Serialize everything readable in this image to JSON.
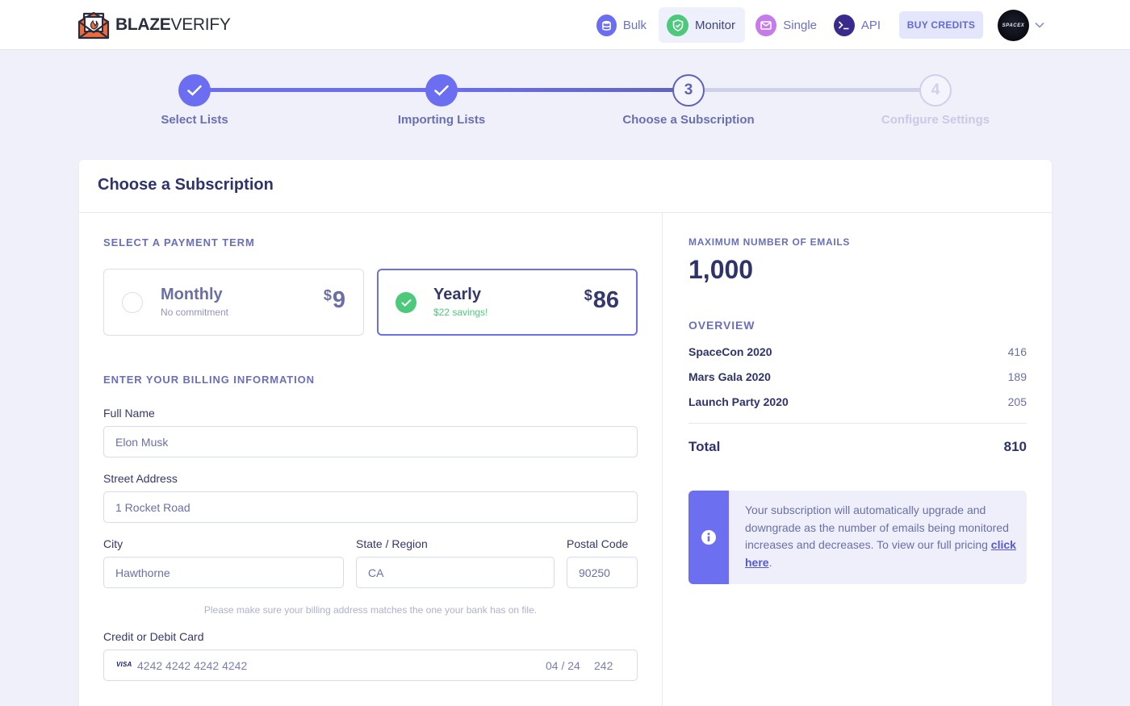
{
  "brand": {
    "name_bold": "BLAZE",
    "name_light": "VERIFY"
  },
  "nav": {
    "items": [
      {
        "label": "Bulk",
        "icon": "database-icon",
        "color": "#6b6ef0"
      },
      {
        "label": "Monitor",
        "icon": "shield-check-icon",
        "color": "#4cc97a",
        "active": true
      },
      {
        "label": "Single",
        "icon": "envelope-icon",
        "color": "#c57be8"
      },
      {
        "label": "API",
        "icon": "terminal-icon",
        "color": "#3a2a8e"
      }
    ],
    "buy_credits": "BUY CREDITS",
    "avatar_text": "SPACEX"
  },
  "stepper": {
    "steps": [
      {
        "label": "Select Lists",
        "state": "done",
        "number": "1"
      },
      {
        "label": "Importing Lists",
        "state": "done",
        "number": "2"
      },
      {
        "label": "Choose a Subscription",
        "state": "current",
        "number": "3"
      },
      {
        "label": "Configure Settings",
        "state": "todo",
        "number": "4"
      }
    ]
  },
  "card": {
    "title": "Choose a Subscription",
    "payment_term_label": "SELECT A PAYMENT TERM",
    "terms": {
      "monthly": {
        "name": "Monthly",
        "sub": "No commitment",
        "currency": "$",
        "price": "9",
        "selected": false
      },
      "yearly": {
        "name": "Yearly",
        "sub": "$22 savings!",
        "currency": "$",
        "price": "86",
        "selected": true
      }
    },
    "billing_label": "ENTER YOUR BILLING INFORMATION",
    "fields": {
      "full_name": {
        "label": "Full Name",
        "value": "Elon Musk"
      },
      "street": {
        "label": "Street Address",
        "value": "1 Rocket Road"
      },
      "city": {
        "label": "City",
        "value": "Hawthorne"
      },
      "state": {
        "label": "State / Region",
        "value": "CA"
      },
      "postal": {
        "label": "Postal Code",
        "value": "90250"
      }
    },
    "billing_help": "Please make sure your billing address matches the one your bank has on file.",
    "card_field": {
      "label": "Credit or Debit Card",
      "brand": "VISA",
      "number": "4242 4242 4242 4242",
      "expiry": "04 / 24",
      "cvc": "242"
    }
  },
  "summary": {
    "max_label": "MAXIMUM NUMBER OF EMAILS",
    "max_value": "1,000",
    "overview_label": "OVERVIEW",
    "rows": [
      {
        "name": "SpaceCon 2020",
        "value": "416"
      },
      {
        "name": "Mars Gala 2020",
        "value": "189"
      },
      {
        "name": "Launch Party 2020",
        "value": "205"
      }
    ],
    "total_label": "Total",
    "total_value": "810",
    "info_text": "Your subscription will automatically upgrade and downgrade as the number of emails being monitored increases and decreases. To view our full pricing ",
    "info_link": "click here",
    "info_end": "."
  }
}
